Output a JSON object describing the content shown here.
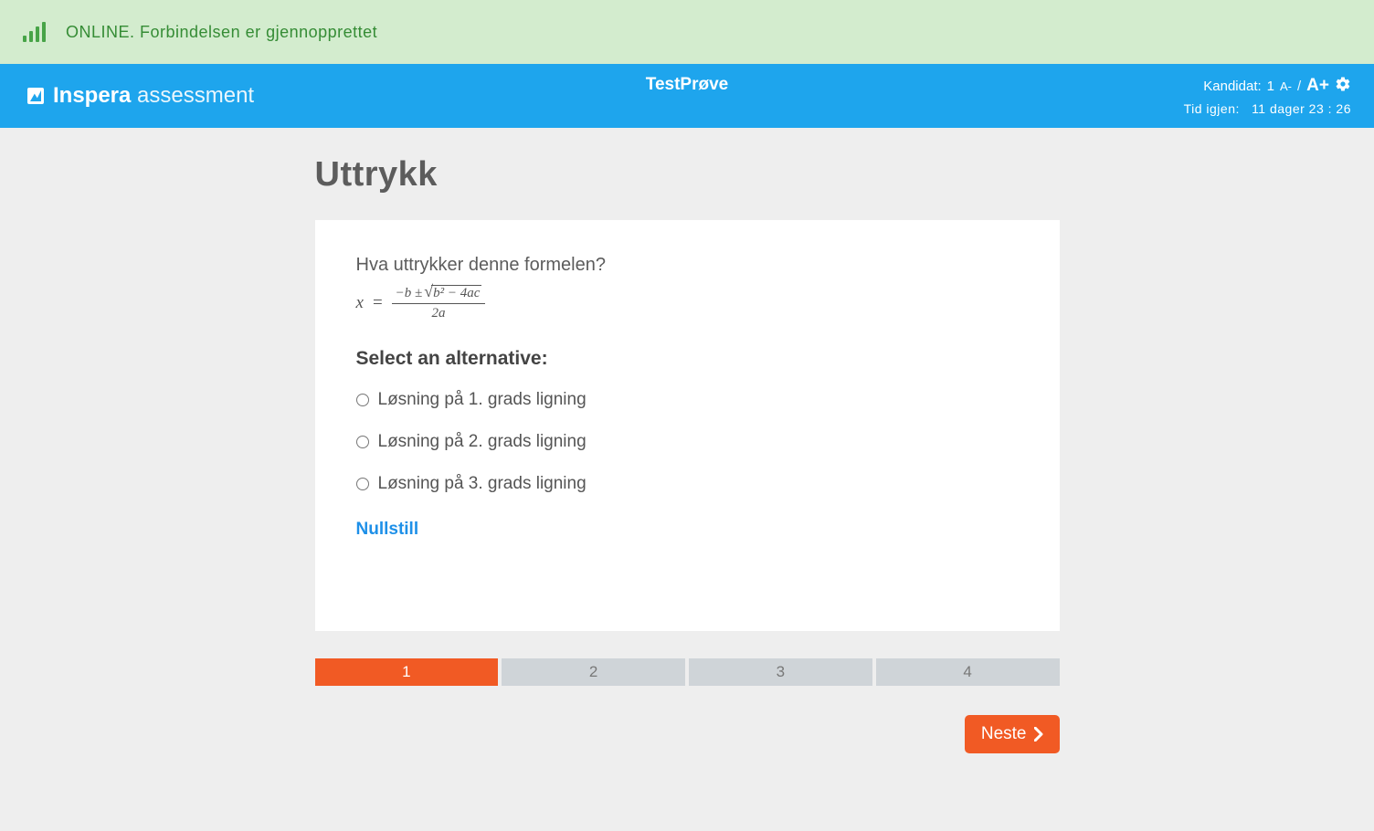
{
  "status": {
    "text": "ONLINE. Forbindelsen er gjennopprettet"
  },
  "header": {
    "brand_bold": "Inspera",
    "brand_light": " assessment",
    "center_title": "TestPrøve",
    "candidate_label": "Kandidat:",
    "candidate_id": "1",
    "font_small": "A-",
    "font_sep": "/",
    "font_large": "A+",
    "time_label": "Tid igjen:",
    "time_value": "11 dager 23 : 26"
  },
  "page": {
    "title": "Uttrykk"
  },
  "question": {
    "prompt": "Hva uttrykker denne formelen?",
    "formula_lhs": "x",
    "formula_eq": "=",
    "formula_num_prefix": "−b ±",
    "formula_radicand": "b² − 4ac",
    "formula_den": "2a",
    "select_heading": "Select an alternative:",
    "alternatives": [
      "Løsning på 1. grads ligning",
      "Løsning på 2. grads ligning",
      "Løsning på 3. grads ligning"
    ],
    "reset_label": "Nullstill"
  },
  "pager": {
    "pages": [
      "1",
      "2",
      "3",
      "4"
    ],
    "active_index": 0
  },
  "actions": {
    "next_label": "Neste"
  },
  "colors": {
    "accent_orange": "#f15a24",
    "accent_blue": "#1ea5ed",
    "status_green": "#d3ecce"
  }
}
